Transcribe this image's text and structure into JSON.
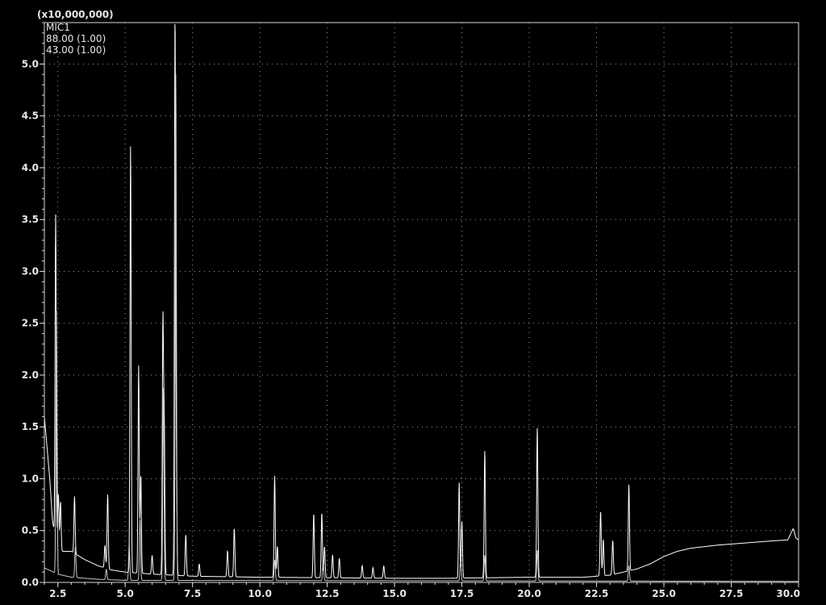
{
  "chart_data": {
    "type": "line",
    "scale_label": "(x10,000,000)",
    "legend": [
      "MIC1",
      "88.00 (1.00)",
      "43.00 (1.00)"
    ],
    "xlim": [
      2.0,
      30.0
    ],
    "ylim": [
      0.0,
      5.4
    ],
    "grid": true,
    "x_ticks": [
      2.5,
      5.0,
      7.5,
      10.0,
      12.5,
      15.0,
      17.5,
      20.0,
      22.5,
      25.0,
      27.5,
      30.0
    ],
    "x_tick_labels": [
      "2.5",
      "5.0",
      "7.5",
      "10.0",
      "12.5",
      "15.0",
      "17.5",
      "20.0",
      "22.5",
      "25.0",
      "27.5",
      "30.0"
    ],
    "y_ticks": [
      0.0,
      0.5,
      1.0,
      1.5,
      2.0,
      2.5,
      3.0,
      3.5,
      4.0,
      4.5,
      5.0
    ],
    "y_tick_labels": [
      "0.0",
      "0.5",
      "1.0",
      "1.5",
      "2.0",
      "2.5",
      "3.0",
      "3.5",
      "4.0",
      "4.5",
      "5.0"
    ],
    "series": [
      {
        "color": "#ffffff",
        "baseline": [
          [
            2.0,
            1.6
          ],
          [
            2.1,
            1.3
          ],
          [
            2.2,
            1.0
          ],
          [
            2.3,
            0.6
          ],
          [
            2.45,
            0.35
          ],
          [
            2.6,
            0.3
          ],
          [
            3.0,
            0.3
          ],
          [
            3.5,
            0.22
          ],
          [
            4.0,
            0.16
          ],
          [
            4.5,
            0.12
          ],
          [
            5.0,
            0.1
          ],
          [
            6.0,
            0.08
          ],
          [
            7.5,
            0.06
          ],
          [
            10.0,
            0.05
          ],
          [
            15.0,
            0.04
          ],
          [
            17.0,
            0.04
          ],
          [
            20.0,
            0.05
          ],
          [
            22.0,
            0.05
          ],
          [
            23.0,
            0.07
          ],
          [
            24.0,
            0.13
          ],
          [
            24.5,
            0.18
          ],
          [
            25.0,
            0.25
          ],
          [
            25.5,
            0.3
          ],
          [
            26.0,
            0.33
          ],
          [
            27.0,
            0.36
          ],
          [
            27.5,
            0.37
          ],
          [
            28.0,
            0.38
          ],
          [
            29.0,
            0.4
          ],
          [
            29.6,
            0.41
          ],
          [
            29.8,
            0.52
          ],
          [
            29.9,
            0.43
          ],
          [
            30.0,
            0.41
          ]
        ],
        "peaks": [
          [
            2.42,
            3.15
          ],
          [
            2.52,
            0.53
          ],
          [
            2.6,
            0.48
          ],
          [
            3.12,
            0.55
          ],
          [
            4.25,
            0.22
          ],
          [
            4.35,
            0.72
          ],
          [
            5.2,
            4.12
          ],
          [
            5.5,
            2.0
          ],
          [
            5.58,
            0.95
          ],
          [
            6.0,
            0.18
          ],
          [
            6.4,
            2.42
          ],
          [
            6.45,
            1.45
          ],
          [
            6.85,
            5.35
          ],
          [
            6.9,
            0.98
          ],
          [
            7.25,
            0.4
          ],
          [
            7.75,
            0.12
          ],
          [
            8.8,
            0.25
          ],
          [
            9.05,
            0.47
          ],
          [
            10.55,
            0.98
          ],
          [
            10.65,
            0.3
          ],
          [
            12.0,
            0.62
          ],
          [
            12.3,
            0.63
          ],
          [
            12.4,
            0.3
          ],
          [
            12.7,
            0.22
          ],
          [
            12.95,
            0.19
          ],
          [
            13.8,
            0.12
          ],
          [
            14.2,
            0.1
          ],
          [
            14.6,
            0.12
          ],
          [
            17.4,
            0.92
          ],
          [
            17.5,
            0.55
          ],
          [
            18.35,
            1.23
          ],
          [
            20.3,
            1.45
          ],
          [
            22.65,
            0.63
          ],
          [
            22.75,
            0.35
          ],
          [
            23.1,
            0.33
          ],
          [
            23.7,
            0.83
          ]
        ]
      },
      {
        "color": "#c8c8c8",
        "baseline": [
          [
            2.0,
            0.14
          ],
          [
            2.5,
            0.08
          ],
          [
            3.0,
            0.05
          ],
          [
            4.0,
            0.03
          ],
          [
            5.0,
            0.02
          ],
          [
            30.0,
            0.01
          ]
        ],
        "peaks": [
          [
            2.45,
            2.55
          ],
          [
            3.15,
            0.3
          ],
          [
            4.3,
            0.1
          ],
          [
            5.15,
            0.35
          ],
          [
            5.55,
            0.6
          ],
          [
            6.42,
            1.9
          ],
          [
            6.88,
            4.9
          ],
          [
            10.55,
            0.2
          ],
          [
            12.35,
            0.18
          ],
          [
            17.45,
            0.2
          ],
          [
            18.35,
            0.25
          ],
          [
            20.3,
            0.3
          ],
          [
            23.7,
            0.15
          ]
        ]
      }
    ]
  }
}
